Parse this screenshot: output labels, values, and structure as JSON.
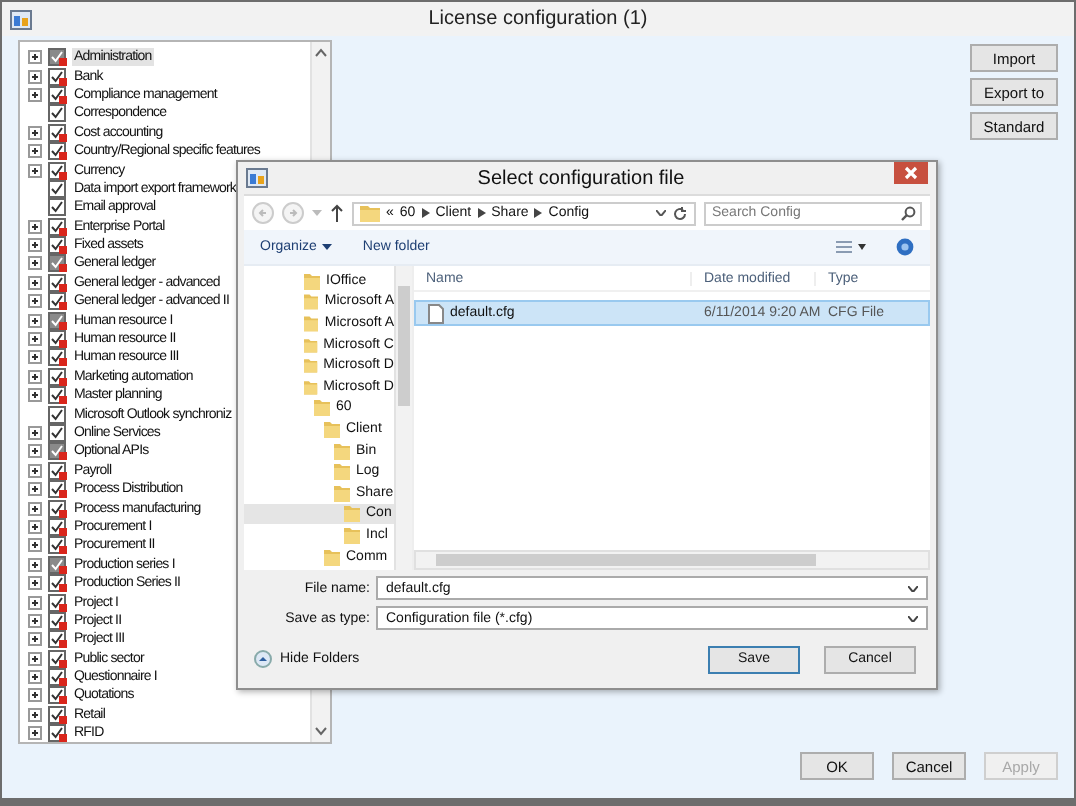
{
  "window": {
    "title": "License configuration (1)"
  },
  "tree": {
    "items": [
      {
        "label": "Administration",
        "kind": "dark",
        "expandable": true,
        "selected": true
      },
      {
        "label": "Bank",
        "kind": "locked",
        "expandable": true,
        "selected": false
      },
      {
        "label": "Compliance management",
        "kind": "locked",
        "expandable": true,
        "selected": false
      },
      {
        "label": "Correspondence",
        "kind": "plain",
        "expandable": false,
        "selected": false
      },
      {
        "label": "Cost accounting",
        "kind": "locked",
        "expandable": true,
        "selected": false
      },
      {
        "label": "Country/Regional specific features",
        "kind": "locked",
        "expandable": true,
        "selected": false
      },
      {
        "label": "Currency",
        "kind": "locked",
        "expandable": true,
        "selected": false
      },
      {
        "label": "Data import export framework",
        "kind": "plain",
        "expandable": false,
        "selected": false
      },
      {
        "label": "Email approval",
        "kind": "plain",
        "expandable": false,
        "selected": false
      },
      {
        "label": "Enterprise Portal",
        "kind": "locked",
        "expandable": true,
        "selected": false
      },
      {
        "label": "Fixed assets",
        "kind": "locked",
        "expandable": true,
        "selected": false
      },
      {
        "label": "General ledger",
        "kind": "dark",
        "expandable": true,
        "selected": false
      },
      {
        "label": "General ledger - advanced",
        "kind": "locked",
        "expandable": true,
        "selected": false
      },
      {
        "label": "General ledger - advanced II",
        "kind": "locked",
        "expandable": true,
        "selected": false
      },
      {
        "label": "Human resource I",
        "kind": "dark",
        "expandable": true,
        "selected": false
      },
      {
        "label": "Human resource II",
        "kind": "locked",
        "expandable": true,
        "selected": false
      },
      {
        "label": "Human resource III",
        "kind": "locked",
        "expandable": true,
        "selected": false
      },
      {
        "label": "Marketing automation",
        "kind": "locked",
        "expandable": true,
        "selected": false
      },
      {
        "label": "Master planning",
        "kind": "locked",
        "expandable": true,
        "selected": false
      },
      {
        "label": "Microsoft Outlook synchroniz",
        "kind": "plain",
        "expandable": false,
        "selected": false
      },
      {
        "label": "Online Services",
        "kind": "plain",
        "expandable": true,
        "selected": false
      },
      {
        "label": "Optional APIs",
        "kind": "dark",
        "expandable": true,
        "selected": false
      },
      {
        "label": "Payroll",
        "kind": "locked",
        "expandable": true,
        "selected": false
      },
      {
        "label": "Process Distribution",
        "kind": "locked",
        "expandable": true,
        "selected": false
      },
      {
        "label": "Process manufacturing",
        "kind": "locked",
        "expandable": true,
        "selected": false
      },
      {
        "label": "Procurement I",
        "kind": "locked",
        "expandable": true,
        "selected": false
      },
      {
        "label": "Procurement II",
        "kind": "locked",
        "expandable": true,
        "selected": false
      },
      {
        "label": "Production series I",
        "kind": "dark",
        "expandable": true,
        "selected": false
      },
      {
        "label": "Production Series II",
        "kind": "locked",
        "expandable": true,
        "selected": false
      },
      {
        "label": "Project I",
        "kind": "locked",
        "expandable": true,
        "selected": false
      },
      {
        "label": "Project II",
        "kind": "locked",
        "expandable": true,
        "selected": false
      },
      {
        "label": "Project III",
        "kind": "locked",
        "expandable": true,
        "selected": false
      },
      {
        "label": "Public sector",
        "kind": "locked",
        "expandable": true,
        "selected": false
      },
      {
        "label": "Questionnaire I",
        "kind": "locked",
        "expandable": true,
        "selected": false
      },
      {
        "label": "Quotations",
        "kind": "locked",
        "expandable": true,
        "selected": false
      },
      {
        "label": "Retail",
        "kind": "locked",
        "expandable": true,
        "selected": false
      },
      {
        "label": "RFID",
        "kind": "locked",
        "expandable": true,
        "selected": false
      }
    ]
  },
  "side_buttons": [
    "Import",
    "Export to",
    "Standard"
  ],
  "footer_buttons": [
    {
      "label": "OK",
      "disabled": false
    },
    {
      "label": "Cancel",
      "disabled": false
    },
    {
      "label": "Apply",
      "disabled": true
    }
  ],
  "dialog": {
    "title": "Select configuration file",
    "breadcrumb": [
      "«",
      "60",
      "Client",
      "Share",
      "Config"
    ],
    "search": {
      "placeholder": "Search Config"
    },
    "toolbar": [
      "Organize",
      "New folder"
    ],
    "folders": [
      {
        "label": "IOffice",
        "selected": false
      },
      {
        "label": "Microsoft A",
        "selected": false
      },
      {
        "label": "Microsoft A",
        "selected": false
      },
      {
        "label": "Microsoft C",
        "selected": false
      },
      {
        "label": "Microsoft D",
        "selected": false
      },
      {
        "label": "Microsoft D",
        "selected": false,
        "children": [
          {
            "label": "60",
            "selected": false,
            "children": [
              {
                "label": "Client",
                "selected": false,
                "children": [
                  {
                    "label": "Bin",
                    "selected": false
                  },
                  {
                    "label": "Log",
                    "selected": false
                  },
                  {
                    "label": "Share",
                    "selected": false,
                    "children": [
                      {
                        "label": "Con",
                        "selected": true
                      },
                      {
                        "label": "Incl",
                        "selected": false
                      }
                    ]
                  }
                ]
              },
              {
                "label": "Comm",
                "selected": false
              }
            ]
          }
        ]
      }
    ],
    "columns": [
      "Name",
      "Date modified",
      "Type"
    ],
    "files": [
      {
        "name": "default.cfg",
        "date": "6/11/2014 9:20 AM",
        "type": "CFG File",
        "selected": true
      }
    ],
    "file_name": {
      "label": "File name:",
      "value": "default.cfg"
    },
    "save_type": {
      "label": "Save as type:",
      "value": "Configuration file (*.cfg)"
    },
    "hide_folders": "Hide Folders",
    "buttons": [
      "Save",
      "Cancel"
    ]
  }
}
